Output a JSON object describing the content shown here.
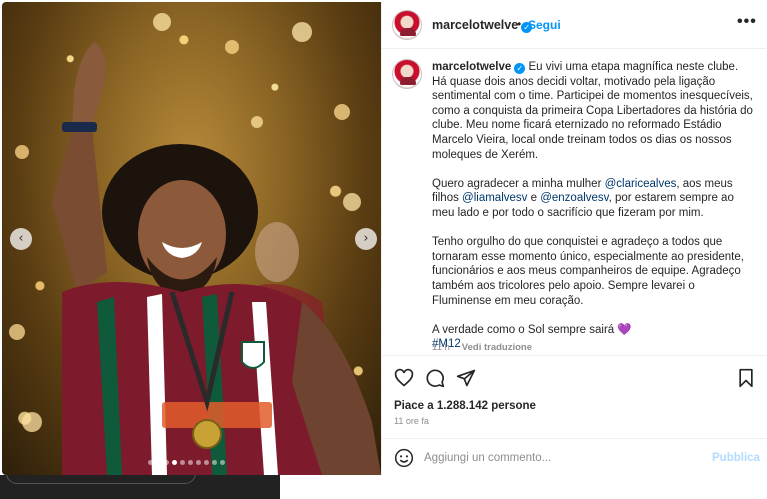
{
  "post": {
    "username": "marcelotwelve",
    "follow_label": "Segui",
    "separator": "•",
    "more_label": "•••",
    "caption_paragraphs": [
      "Eu vivi uma etapa magnífica neste clube. Há quase dois anos decidi voltar, motivado pela ligação sentimental com o time. Participei de momentos inesquecíveis, como a conquista da primeira Copa Libertadores da história do clube. Meu nome ficará eternizado no reformado Estádio Marcelo Vieira, local onde treinam todos os dias os nossos moleques de Xerém."
    ],
    "para2": {
      "t1": "Quero agradecer a minha mulher ",
      "m1": "@claricealves",
      "t2": ", aos meus filhos ",
      "m2": "@liamalvesv",
      "t3": " e ",
      "m3": "@enzoalvesv",
      "t4": ", por estarem sempre ao meu lado e por todo o sacrifício que fizeram por mim."
    },
    "para3": "Tenho orgulho do que conquistei e agradeço a todos que tornaram esse momento único, especialmente ao presidente, funcionários e aos meus companheiros de equipe. Agradeço também aos tricolores pelo apoio. Sempre levarei o Fluminense em meu coração.",
    "para4": "A verdade como o Sol sempre sairá 💜",
    "hashtag": "#M12",
    "caption_time": "11 h",
    "see_translation": "Vedi traduzione",
    "likes": "Piace a 1.288.142 persone",
    "time_ago": "11 ore fa",
    "comment_placeholder": "Aggiungi un commento...",
    "publish_label": "Pubblica"
  },
  "photo": {
    "carousel_dots": 10,
    "active_dot": 3,
    "prev_icon": "chevron-left-icon",
    "next_icon": "chevron-right-icon"
  },
  "colors": {
    "accent": "#0095f6",
    "link": "#00376b",
    "muted": "#8e8e8e",
    "publish_disabled": "#b3dbff"
  }
}
